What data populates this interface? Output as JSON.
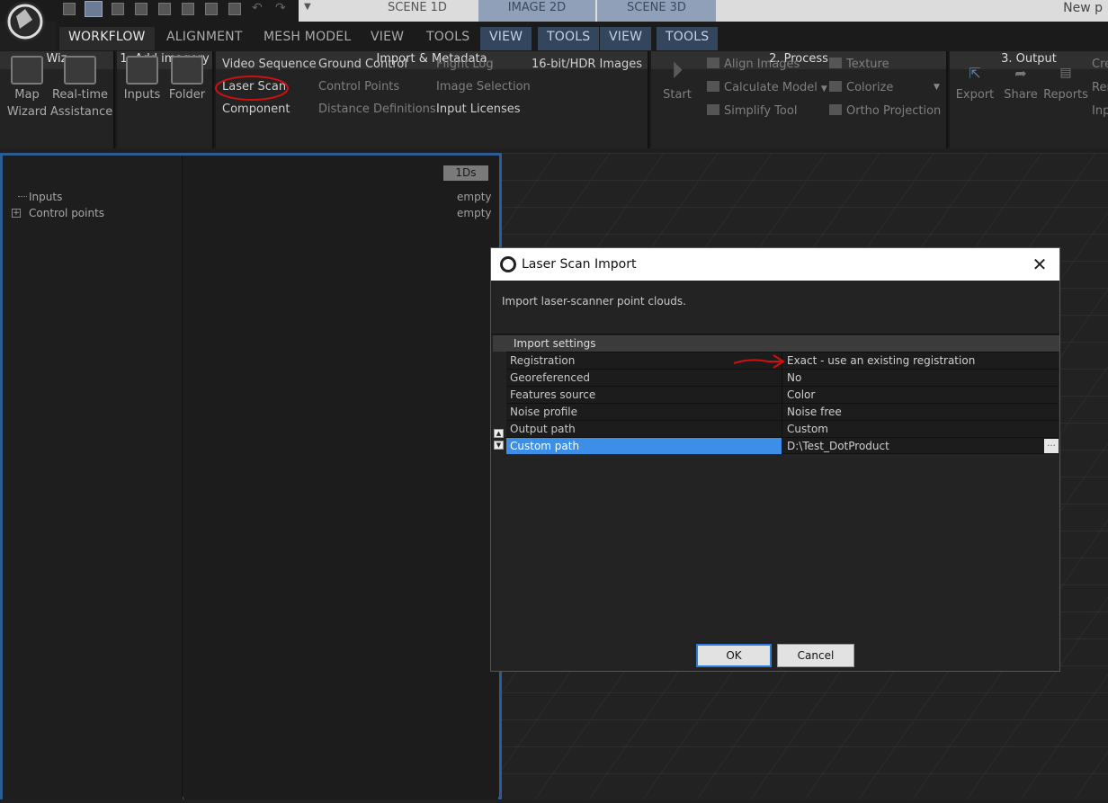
{
  "scene_tabs": [
    "SCENE 1D",
    "IMAGE 2D",
    "SCENE 3D"
  ],
  "project_title": "New p",
  "menu_tabs": [
    "WORKFLOW",
    "ALIGNMENT",
    "MESH MODEL",
    "VIEW",
    "TOOLS",
    "VIEW",
    "TOOLS",
    "VIEW",
    "TOOLS"
  ],
  "ribbon": {
    "wiz": {
      "map_wizard": [
        "Map",
        "Wizard"
      ],
      "realtime": [
        "Real-time",
        "Assistance"
      ],
      "footer": "Wiz"
    },
    "add_imagery": {
      "inputs": "Inputs",
      "folder": "Folder",
      "footer": "1. Add imagery"
    },
    "import": {
      "col1": [
        "Video Sequence",
        "Laser Scan",
        "Component"
      ],
      "col2": [
        "Ground Control",
        "Control Points",
        "Distance Definitions"
      ],
      "col3": [
        "Flight Log",
        "Image Selection",
        "Input Licenses"
      ],
      "col4": [
        "16-bit/HDR Images"
      ],
      "footer": "Import & Metadata"
    },
    "process": {
      "start": "Start",
      "col1": [
        "Align Images",
        "Calculate Model",
        "Simplify Tool"
      ],
      "col2": [
        "Texture",
        "Colorize",
        "Ortho Projection"
      ],
      "footer": "2. Process"
    },
    "output": {
      "buttons": [
        "Export",
        "Share",
        "Reports"
      ],
      "col": [
        "Cre",
        "Ren",
        "Inp"
      ],
      "footer": "3. Output"
    }
  },
  "tree": {
    "items": [
      "Inputs",
      "Control points"
    ]
  },
  "detail": {
    "badge": "1Ds",
    "values": [
      "empty",
      "empty"
    ]
  },
  "dialog": {
    "title": "Laser Scan Import",
    "close": "✕",
    "description": "Import laser-scanner point clouds.",
    "section": "Import settings",
    "rows": [
      {
        "name": "Registration",
        "value": "Exact - use an existing registration"
      },
      {
        "name": "Georeferenced",
        "value": "No"
      },
      {
        "name": "Features source",
        "value": "Color"
      },
      {
        "name": "Noise profile",
        "value": "Noise free"
      },
      {
        "name": "Output path",
        "value": "Custom"
      },
      {
        "name": "Custom path",
        "value": "D:\\Test_DotProduct"
      }
    ],
    "browse": "...",
    "ok": "OK",
    "cancel": "Cancel"
  }
}
